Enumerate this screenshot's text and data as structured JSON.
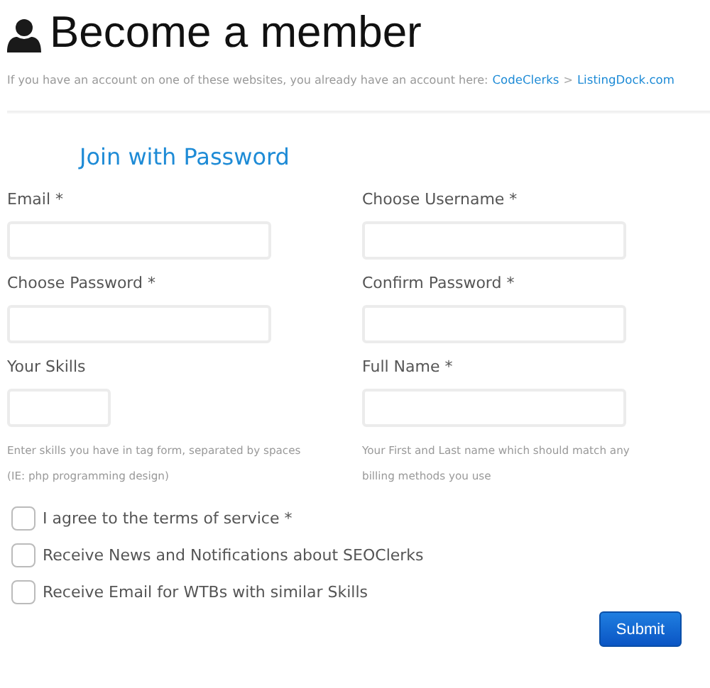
{
  "header": {
    "title": "Become a member",
    "intro": "If you have an account on one of these websites, you already have an account here:",
    "links": [
      {
        "label": "CodeClerks"
      },
      {
        "label": "ListingDock.com"
      }
    ],
    "separator": ">"
  },
  "form": {
    "heading": "Join with Password",
    "fields": [
      {
        "label": "Email *",
        "kind": "wide"
      },
      {
        "label": "Choose Username *",
        "kind": "wide"
      },
      {
        "label": "Choose Password *",
        "kind": "wide"
      },
      {
        "label": "Confirm Password *",
        "kind": "wide"
      },
      {
        "label": "Your Skills",
        "kind": "narrow",
        "help": "Enter skills you have in tag form, separated by spaces (IE: php programming design)"
      },
      {
        "label": "Full Name *",
        "kind": "wide",
        "help": "Your First and Last name which should match any billing methods you use"
      }
    ],
    "checkboxes": [
      {
        "label": "I agree to the terms of service *",
        "checked": false
      },
      {
        "label": "Receive News and Notifications about SEOClerks",
        "checked": false
      },
      {
        "label": "Receive Email for WTBs with similar Skills",
        "checked": false
      }
    ],
    "submit": "Submit"
  }
}
